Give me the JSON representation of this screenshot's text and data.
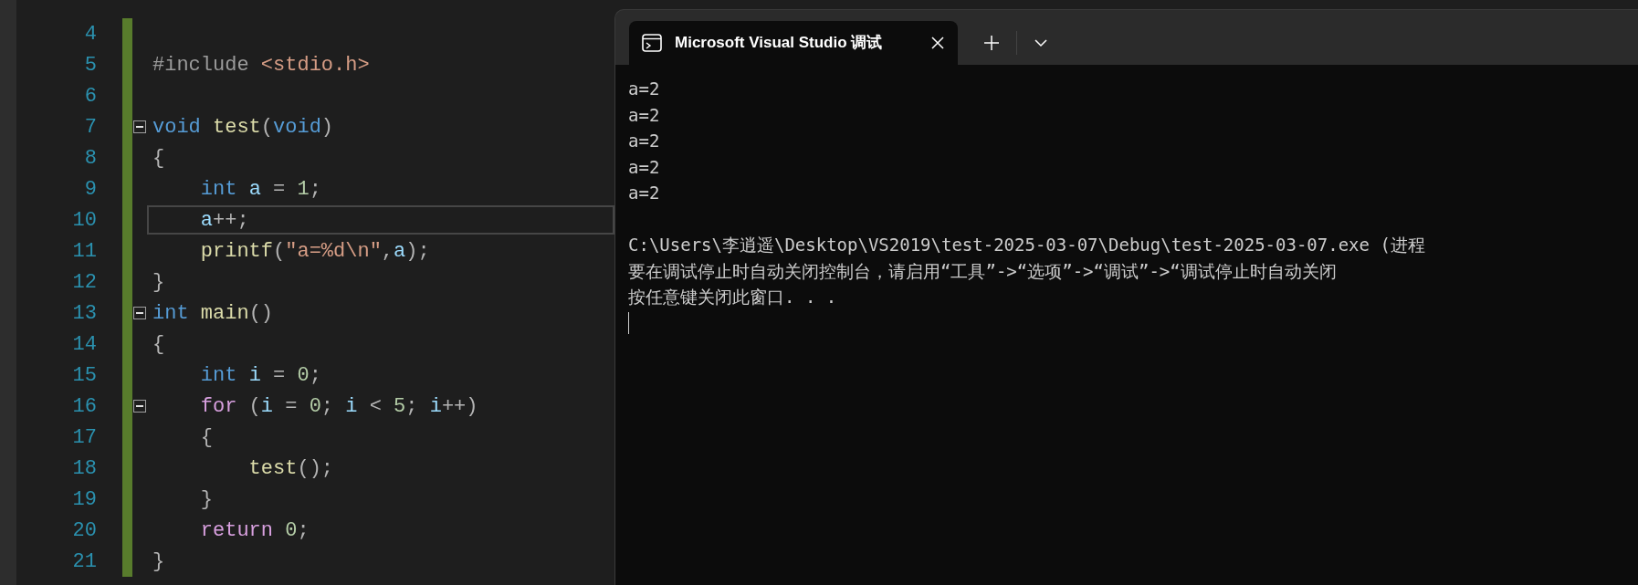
{
  "editor": {
    "lines": [
      {
        "number": "4",
        "fold": false,
        "current": false
      },
      {
        "number": "5",
        "fold": false,
        "current": false,
        "tokens": [
          {
            "kind": "preprocessor",
            "text": "#include "
          },
          {
            "kind": "string",
            "text": "<stdio.h>"
          }
        ]
      },
      {
        "number": "6",
        "fold": false,
        "current": false
      },
      {
        "number": "7",
        "fold": true,
        "current": false,
        "tokens": [
          {
            "kind": "keyword",
            "text": "void "
          },
          {
            "kind": "function",
            "text": "test"
          },
          {
            "kind": "punct",
            "text": "("
          },
          {
            "kind": "keyword",
            "text": "void"
          },
          {
            "kind": "punct",
            "text": ")"
          }
        ]
      },
      {
        "number": "8",
        "fold": false,
        "current": false,
        "tokens": [
          {
            "kind": "punct",
            "text": "{"
          }
        ]
      },
      {
        "number": "9",
        "fold": false,
        "current": false,
        "tokens": [
          {
            "kind": "keyword",
            "text": "    int "
          },
          {
            "kind": "variable",
            "text": "a"
          },
          {
            "kind": "punct",
            "text": " = "
          },
          {
            "kind": "number",
            "text": "1"
          },
          {
            "kind": "punct",
            "text": ";"
          }
        ]
      },
      {
        "number": "10",
        "fold": false,
        "current": true,
        "tokens": [
          {
            "kind": "variable",
            "text": "    a"
          },
          {
            "kind": "punct",
            "text": "++;"
          }
        ]
      },
      {
        "number": "11",
        "fold": false,
        "current": false,
        "tokens": [
          {
            "kind": "function",
            "text": "    printf"
          },
          {
            "kind": "punct",
            "text": "("
          },
          {
            "kind": "string",
            "text": "\"a=%d\\n\""
          },
          {
            "kind": "punct",
            "text": ","
          },
          {
            "kind": "variable",
            "text": "a"
          },
          {
            "kind": "punct",
            "text": ");"
          }
        ]
      },
      {
        "number": "12",
        "fold": false,
        "current": false,
        "tokens": [
          {
            "kind": "punct",
            "text": "}"
          }
        ]
      },
      {
        "number": "13",
        "fold": true,
        "current": false,
        "tokens": [
          {
            "kind": "keyword",
            "text": "int "
          },
          {
            "kind": "function",
            "text": "main"
          },
          {
            "kind": "punct",
            "text": "()"
          }
        ]
      },
      {
        "number": "14",
        "fold": false,
        "current": false,
        "tokens": [
          {
            "kind": "punct",
            "text": "{"
          }
        ]
      },
      {
        "number": "15",
        "fold": false,
        "current": false,
        "tokens": [
          {
            "kind": "keyword",
            "text": "    int "
          },
          {
            "kind": "variable",
            "text": "i"
          },
          {
            "kind": "punct",
            "text": " = "
          },
          {
            "kind": "number",
            "text": "0"
          },
          {
            "kind": "punct",
            "text": ";"
          }
        ]
      },
      {
        "number": "16",
        "fold": true,
        "current": false,
        "tokens": [
          {
            "kind": "control",
            "text": "    for"
          },
          {
            "kind": "punct",
            "text": " ("
          },
          {
            "kind": "variable",
            "text": "i"
          },
          {
            "kind": "punct",
            "text": " = "
          },
          {
            "kind": "number",
            "text": "0"
          },
          {
            "kind": "punct",
            "text": "; "
          },
          {
            "kind": "variable",
            "text": "i"
          },
          {
            "kind": "punct",
            "text": " < "
          },
          {
            "kind": "number",
            "text": "5"
          },
          {
            "kind": "punct",
            "text": "; "
          },
          {
            "kind": "variable",
            "text": "i"
          },
          {
            "kind": "punct",
            "text": "++)"
          }
        ]
      },
      {
        "number": "17",
        "fold": false,
        "current": false,
        "tokens": [
          {
            "kind": "punct",
            "text": "    {"
          }
        ]
      },
      {
        "number": "18",
        "fold": false,
        "current": false,
        "tokens": [
          {
            "kind": "function",
            "text": "        test"
          },
          {
            "kind": "punct",
            "text": "();"
          }
        ]
      },
      {
        "number": "19",
        "fold": false,
        "current": false,
        "tokens": [
          {
            "kind": "punct",
            "text": "    }"
          }
        ]
      },
      {
        "number": "20",
        "fold": false,
        "current": false,
        "tokens": [
          {
            "kind": "control",
            "text": "    return "
          },
          {
            "kind": "number",
            "text": "0"
          },
          {
            "kind": "punct",
            "text": ";"
          }
        ]
      },
      {
        "number": "21",
        "fold": false,
        "current": false,
        "tokens": [
          {
            "kind": "punct",
            "text": "}"
          }
        ]
      }
    ]
  },
  "terminal": {
    "tab": {
      "title": "Microsoft Visual Studio 调试",
      "selected": true
    },
    "output": [
      "a=2",
      "a=2",
      "a=2",
      "a=2",
      "a=2"
    ],
    "messages": [
      "C:\\Users\\李逍遥\\Desktop\\VS2019\\test-2025-03-07\\Debug\\test-2025-03-07.exe (进程",
      "要在调试停止时自动关闭控制台，请启用“工具”->“选项”->“调试”->“调试停止时自动关闭",
      "按任意键关闭此窗口. . ."
    ]
  }
}
